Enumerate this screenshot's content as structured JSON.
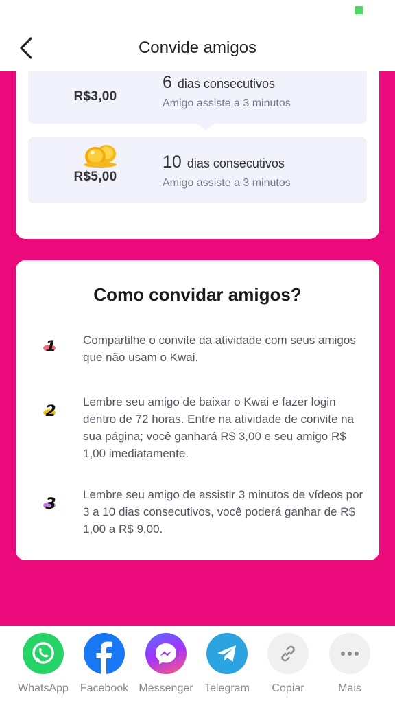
{
  "header": {
    "title": "Convide amigos"
  },
  "rewards": [
    {
      "amount": "R$3,00",
      "days": "6",
      "days_label": "dias consecutivos",
      "condition": "Amigo assiste a 3 minutos"
    },
    {
      "amount": "R$5,00",
      "days": "10",
      "days_label": "dias consecutivos",
      "condition": "Amigo assiste a 3 minutos"
    }
  ],
  "how_to": {
    "title": "Como convidar amigos?",
    "steps": [
      {
        "number": "1",
        "text": "Compartilhe o convite da atividade com seus amigos que não usam o Kwai."
      },
      {
        "number": "2",
        "text": "Lembre seu amigo de baixar o Kwai e fazer login dentro de 72 horas. Entre na atividade de convite na sua página; você ganhará R$ 3,00 e seu amigo R$ 1,00 imediatamente."
      },
      {
        "number": "3",
        "text": "Lembre seu amigo de assistir 3 minutos de vídeos por 3 a 10 dias consecutivos, você poderá ganhar de R$ 1,00 a R$ 9,00."
      }
    ]
  },
  "share": [
    {
      "label": "WhatsApp",
      "icon": "whatsapp-icon",
      "color": "#25d366"
    },
    {
      "label": "Facebook",
      "icon": "facebook-icon",
      "color": "#1877f2"
    },
    {
      "label": "Messenger",
      "icon": "messenger-icon",
      "color": "#a334fa"
    },
    {
      "label": "Telegram",
      "icon": "telegram-icon",
      "color": "#2aa3e0"
    },
    {
      "label": "Copiar",
      "icon": "link-icon",
      "color": "#f0f0f0"
    },
    {
      "label": "Mais",
      "icon": "more-icon",
      "color": "#f0f0f0"
    }
  ],
  "colors": {
    "accent_pink": "#ea0a7c",
    "card_bg": "#f1f2fb"
  }
}
